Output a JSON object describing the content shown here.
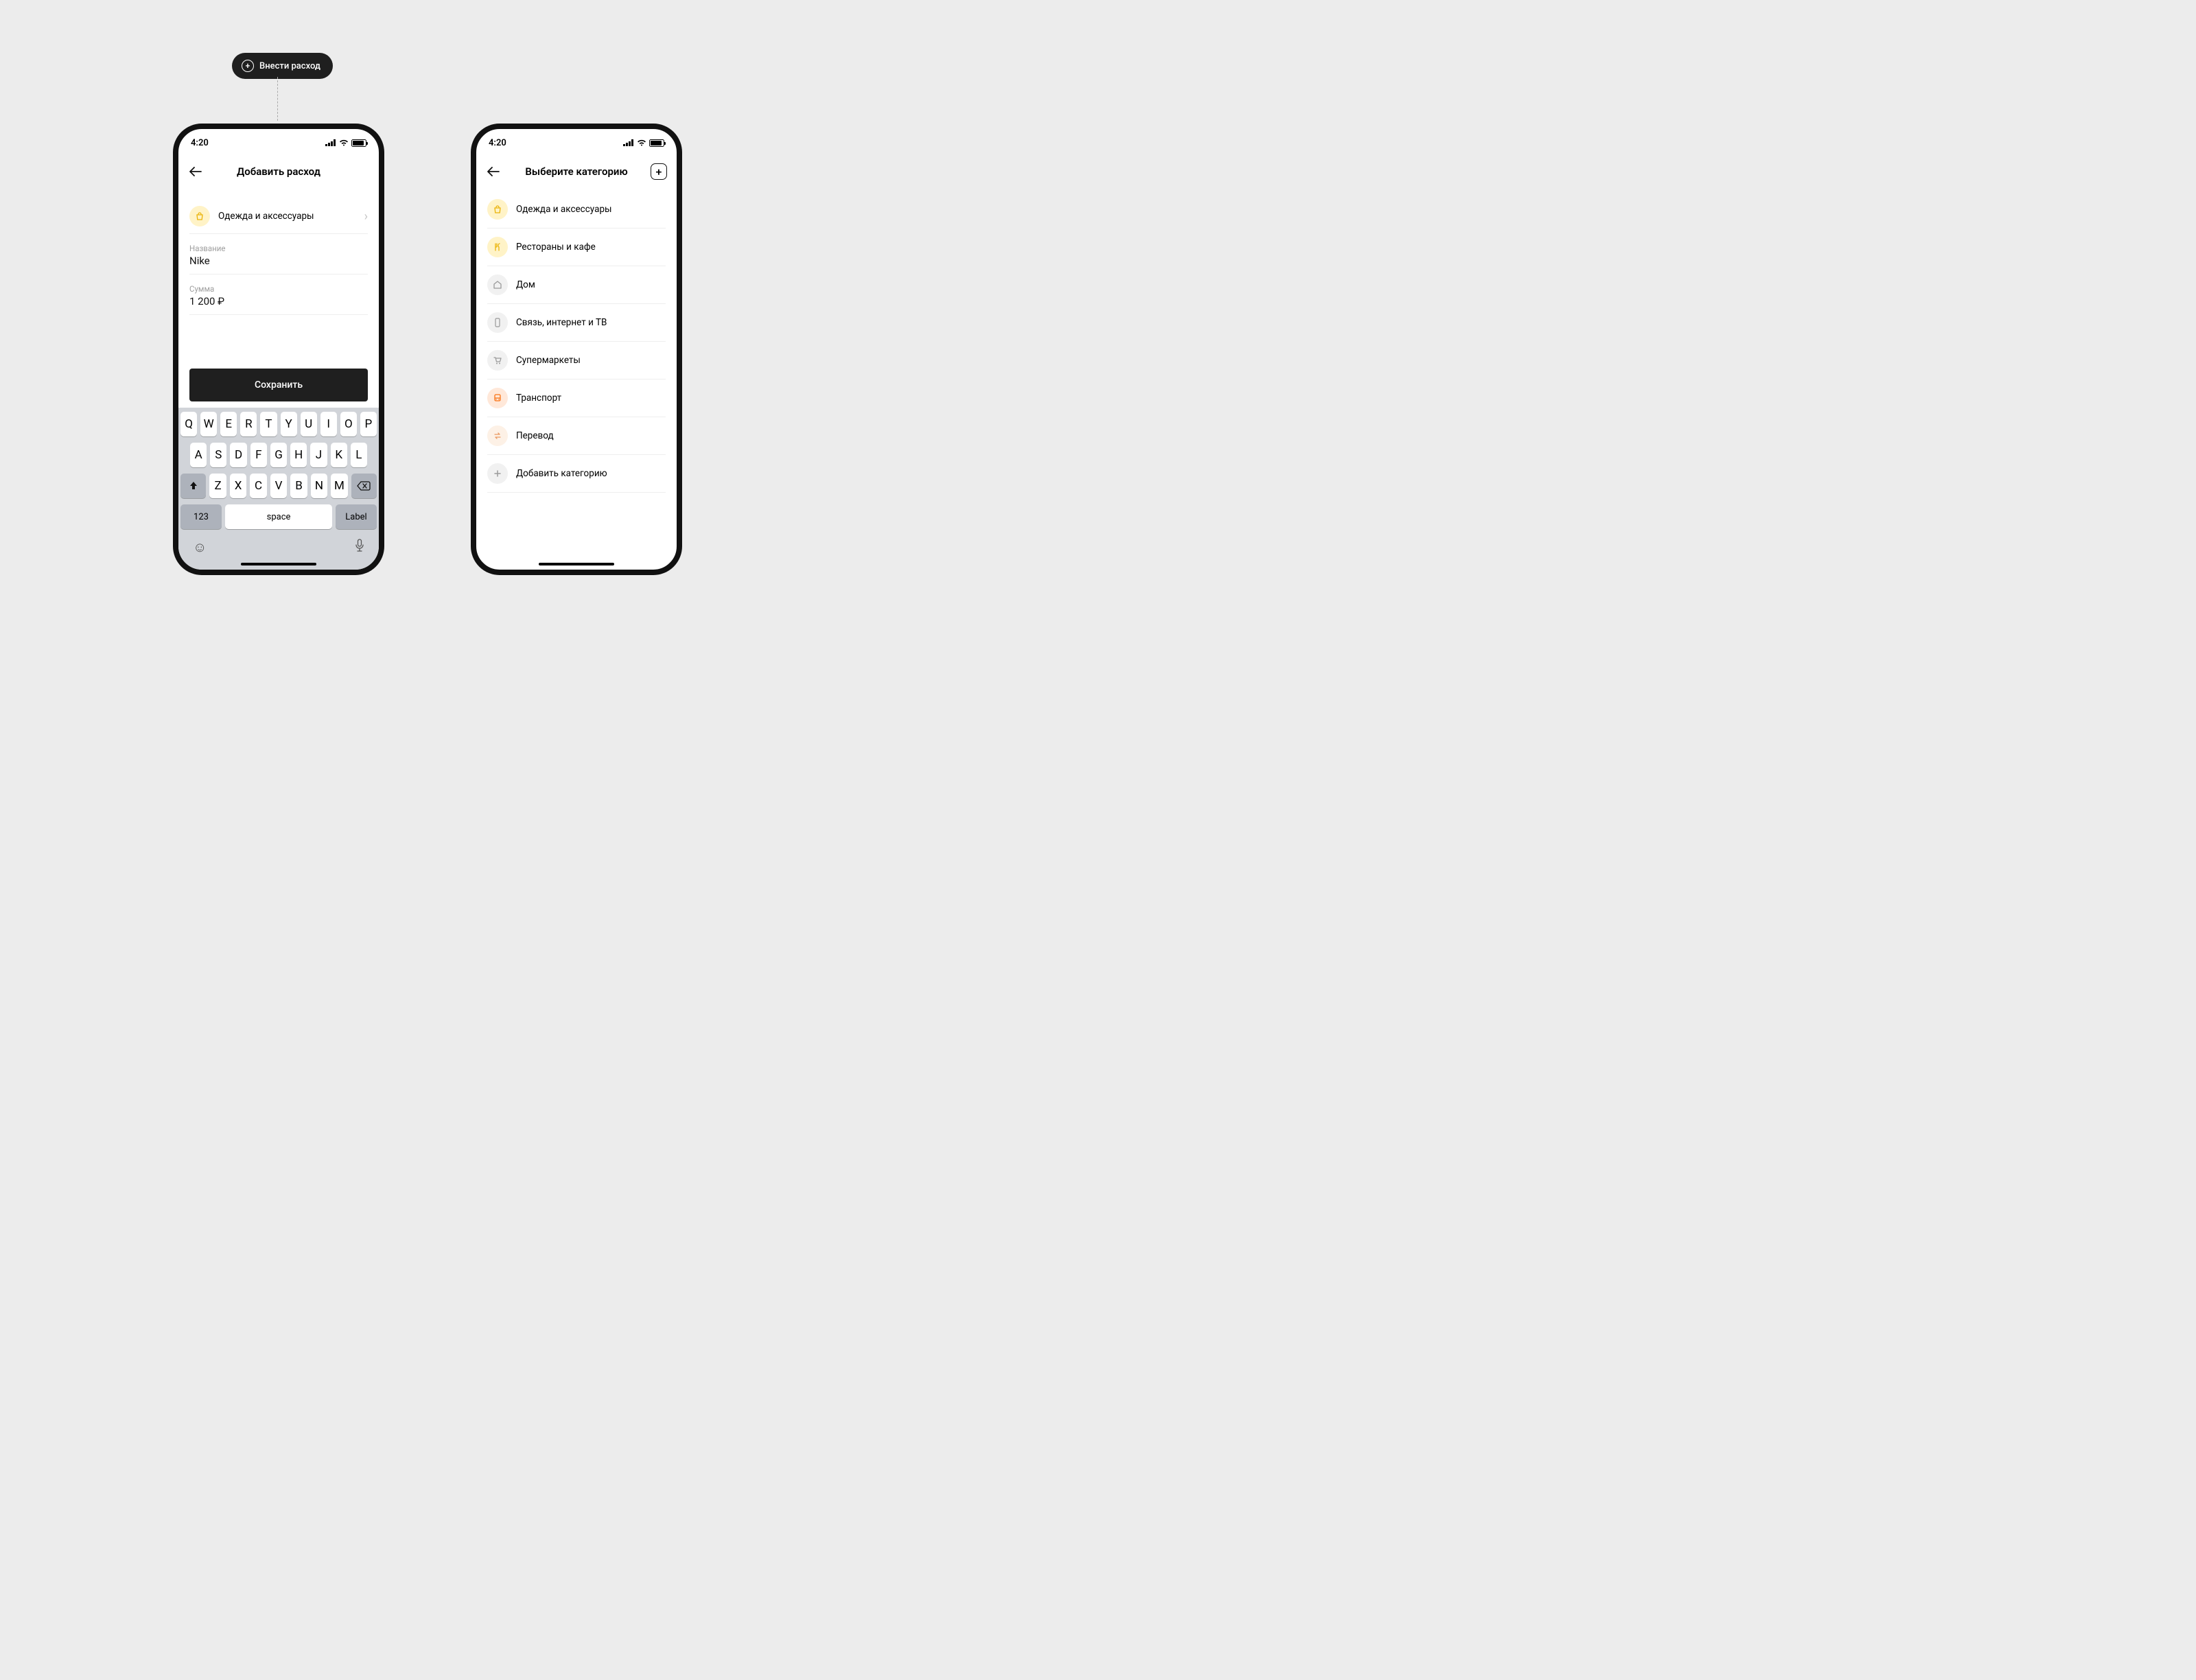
{
  "pill": {
    "label": "Внести расход"
  },
  "status": {
    "time": "4:20"
  },
  "screenA": {
    "title": "Добавить расход",
    "category": {
      "label": "Одежда и аксессуары"
    },
    "name_label": "Название",
    "name_value": "Nike",
    "amount_label": "Сумма",
    "amount_value": "1 200 ₽",
    "save": "Сохранить"
  },
  "keyboard": {
    "row1": [
      "Q",
      "W",
      "E",
      "R",
      "T",
      "Y",
      "U",
      "I",
      "O",
      "P"
    ],
    "row2": [
      "A",
      "S",
      "D",
      "F",
      "G",
      "H",
      "J",
      "K",
      "L"
    ],
    "row3": [
      "Z",
      "X",
      "C",
      "V",
      "B",
      "N",
      "M"
    ],
    "numeric": "123",
    "space": "space",
    "action": "Label"
  },
  "screenB": {
    "title": "Выберите категорию",
    "items": [
      {
        "label": "Одежда и аксессуары",
        "color": "cat-yellow",
        "glyph": "bag"
      },
      {
        "label": "Рестораны и кафе",
        "color": "cat-yellow",
        "glyph": "food"
      },
      {
        "label": "Дом",
        "color": "cat-grey",
        "glyph": "home"
      },
      {
        "label": "Связь, интернет и ТВ",
        "color": "cat-grey",
        "glyph": "phone"
      },
      {
        "label": "Супермаркеты",
        "color": "cat-grey",
        "glyph": "cart"
      },
      {
        "label": "Транспорт",
        "color": "cat-orange",
        "glyph": "bus"
      },
      {
        "label": "Перевод",
        "color": "cat-soft",
        "glyph": "swap"
      },
      {
        "label": "Добавить категорию",
        "color": "cat-grey",
        "glyph": "plus"
      }
    ]
  }
}
